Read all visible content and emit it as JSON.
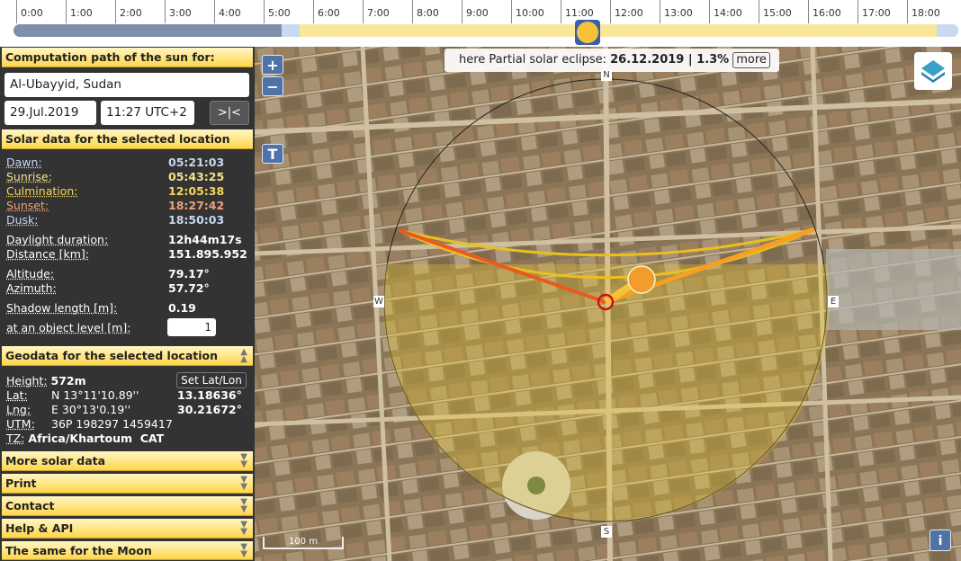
{
  "timeline": {
    "hours": [
      "0:00",
      "1:00",
      "2:00",
      "3:00",
      "4:00",
      "5:00",
      "6:00",
      "7:00",
      "8:00",
      "9:00",
      "10:00",
      "11:00",
      "12:00",
      "13:00",
      "14:00",
      "15:00",
      "16:00",
      "17:00",
      "18:00"
    ],
    "current_time_fraction": 0.477,
    "colors": {
      "night": "#7d8fab",
      "twilight": "#c8daf0",
      "day": "#f9e89a",
      "sun": "#f7c23a"
    }
  },
  "panel": {
    "path_header": "Computation path of the sun for:",
    "location": "Al-Ubayyid, Sudan",
    "date": "29.Jul.2019",
    "time": "11:27 UTC+2",
    "now_button": ">|<",
    "solar_header": "Solar data for the selected location",
    "solar": {
      "dawn_label": "Dawn:",
      "dawn": "05:21:03",
      "sunrise_label": "Sunrise:",
      "sunrise": "05:43:25",
      "culmination_label": "Culmination:",
      "culmination": "12:05:38",
      "sunset_label": "Sunset:",
      "sunset": "18:27:42",
      "dusk_label": "Dusk:",
      "dusk": "18:50:03",
      "daylight_label": "Daylight duration:",
      "daylight": "12h44m17s",
      "distance_label": "Distance [km]:",
      "distance": "151.895.952",
      "altitude_label": "Altitude:",
      "altitude": "79.17°",
      "azimuth_label": "Azimuth:",
      "azimuth": "57.72°",
      "shadow_label": "Shadow length [m]:",
      "shadow": "0.19",
      "object_label": "at an object level [m]:",
      "object_level": "1"
    },
    "geo_header": "Geodata for the selected location",
    "geo": {
      "height_label": "Height:",
      "height": "572m",
      "set_latlon": "Set Lat/Lon",
      "lat_label": "Lat:",
      "lat_dms": "N 13°11'10.89''",
      "lat_dec": "13.18636°",
      "lng_label": "Lng:",
      "lng_dms": "E 30°13'0.19''",
      "lng_dec": "30.21672°",
      "utm_label": "UTM:",
      "utm": "36P 198297 1459417",
      "tz_label": "TZ:",
      "tz": "Africa/Khartoum  CAT"
    },
    "sections": [
      "More solar data",
      "Print",
      "Contact",
      "Help & API",
      "The same for the Moon"
    ]
  },
  "map": {
    "zoom_in": "+",
    "zoom_out": "−",
    "tool_button": "T",
    "eclipse_text": "here Partial solar eclipse:",
    "eclipse_value": "26.12.2019 | 1.3%",
    "eclipse_more": "more",
    "compass": {
      "n": "N",
      "s": "S",
      "e": "E",
      "w": "W"
    },
    "scale": "100 m",
    "info": "i"
  }
}
